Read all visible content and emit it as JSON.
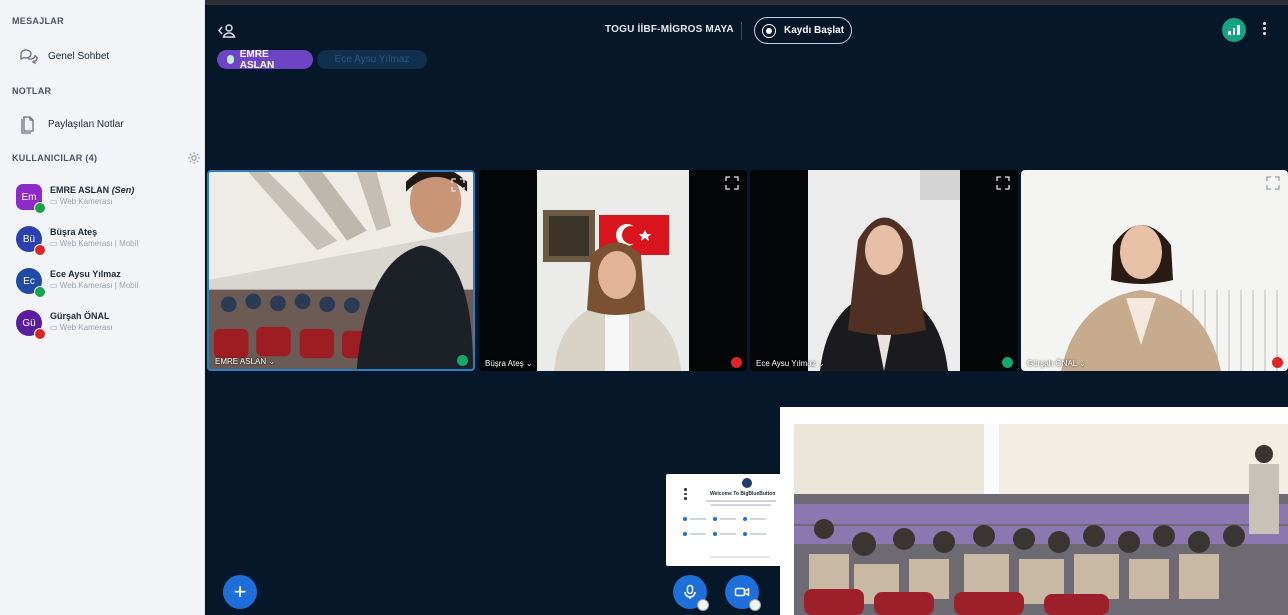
{
  "sidebar": {
    "messages_header": "MESAJLAR",
    "public_chat": "Genel Sohbet",
    "notes_header": "NOTLAR",
    "shared_notes": "Paylaşılan Notlar",
    "users_header": "KULLANICILAR (4)",
    "users": [
      {
        "initials": "Em",
        "name": "EMRE ASLAN",
        "you": "(Sen)",
        "sub": "Web Kamerası",
        "color": "#8e2ac8",
        "badge": "green"
      },
      {
        "initials": "Bü",
        "name": "Büşra Ateş",
        "you": "",
        "sub": "Web Kamerası | Mobil",
        "color": "#2a3fb0",
        "badge": "red"
      },
      {
        "initials": "Ec",
        "name": "Ece Aysu Yılmaz",
        "you": "",
        "sub": "Web Kamerası | Mobil",
        "color": "#1f4aa8",
        "badge": "green"
      },
      {
        "initials": "Gü",
        "name": "Gürşah ÖNAL",
        "you": "",
        "sub": "Web Kamerası",
        "color": "#5b1c9e",
        "badge": "red"
      }
    ]
  },
  "header": {
    "meeting_title": "TOGU İİBF-MİGROS MAYA",
    "record_label": "Kaydı Başlat"
  },
  "talkers": {
    "active": "EMRE ASLAN",
    "inactive": "Ece Aysu Yılmaz"
  },
  "tiles": [
    {
      "name": "EMRE ASLAN",
      "mic": "on"
    },
    {
      "name": "Büşra Ateş",
      "mic": "off"
    },
    {
      "name": "Ece Aysu Yılmaz",
      "mic": "on"
    },
    {
      "name": "Gürşah ÖNAL",
      "mic": "off"
    }
  ],
  "welcome_panel": {
    "title": "Welcome To BigBlueButton"
  },
  "colors": {
    "main_bg": "#06172a",
    "accent_blue": "#1e6fd9",
    "talker_purple": "#6d45c4",
    "connection_green": "#16a37f"
  }
}
